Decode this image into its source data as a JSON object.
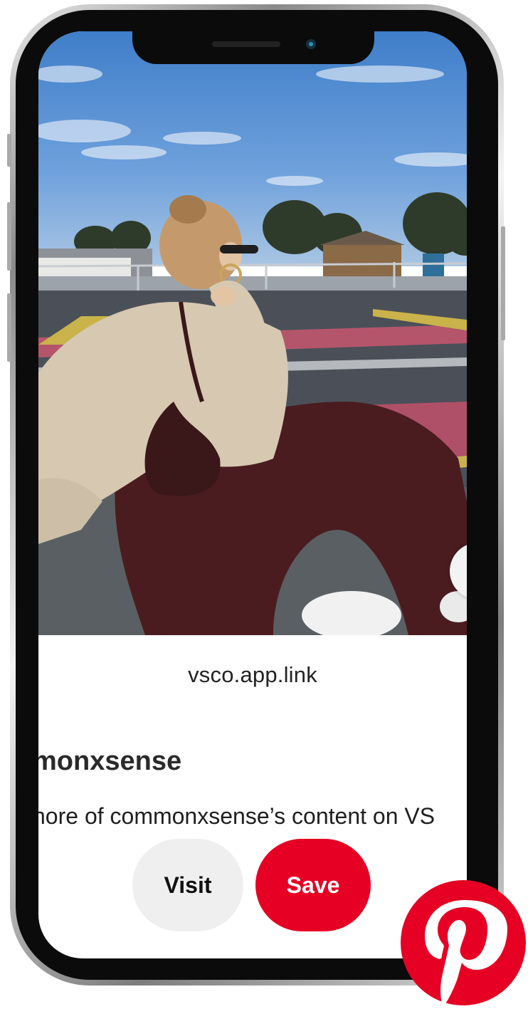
{
  "pin": {
    "domain": "vsco.app.link",
    "title": "commonxsense",
    "description": "See more of commonxsense’s content on VSCO.",
    "visible_title": "monxsense",
    "visible_description": "nore of commonxsense’s content on VS",
    "photo_alt": "photo"
  },
  "actions": {
    "visit_label": "Visit",
    "save_label": "Save"
  },
  "brand": {
    "name": "Pinterest",
    "icon": "pinterest-logo-icon",
    "color": "#e60023"
  },
  "colors": {
    "save_bg": "#e60023",
    "visit_bg": "#efefef"
  }
}
